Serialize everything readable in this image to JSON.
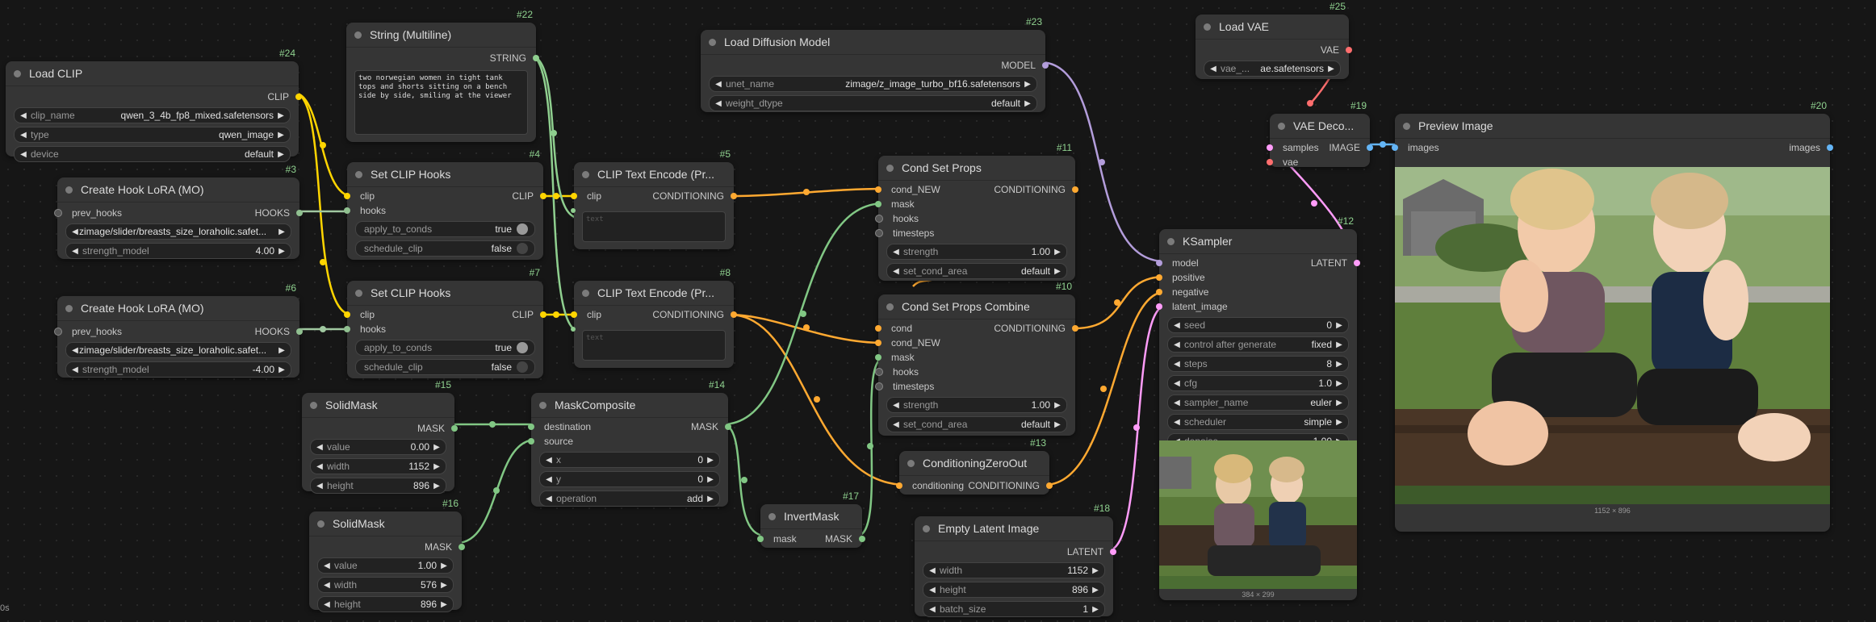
{
  "colors": {
    "clip": "#ffd500",
    "conditioning": "#ffa931",
    "hooks": "#90c090",
    "mask": "#81c784",
    "model": "#b39ddb",
    "latent": "#ff9cf9",
    "vae": "#ff6e6e",
    "image": "#64b5f6",
    "string": "#8fcf8f"
  },
  "footer": {
    "time": "0s"
  },
  "nodes": {
    "load_clip": {
      "id": "#24",
      "title": "Load CLIP",
      "out": "CLIP",
      "clip_name_label": "clip_name",
      "clip_name": "qwen_3_4b_fp8_mixed.safetensors",
      "type_label": "type",
      "type": "qwen_image",
      "device_label": "device",
      "device": "default"
    },
    "string_multiline": {
      "id": "#22",
      "title": "String (Multiline)",
      "out": "STRING",
      "text": "two norwegian women in tight tank tops and shorts sitting on a bench side by side, smiling at the viewer"
    },
    "load_diffusion": {
      "id": "#23",
      "title": "Load Diffusion Model",
      "out": "MODEL",
      "unet_label": "unet_name",
      "unet": "zimage/z_image_turbo_bf16.safetensors",
      "dtype_label": "weight_dtype",
      "dtype": "default"
    },
    "load_vae": {
      "id": "#25",
      "title": "Load VAE",
      "out": "VAE",
      "vae_label": "vae_...",
      "vae": "ae.safetensors"
    },
    "hook_lora_3": {
      "id": "#3",
      "title": "Create Hook LoRA (MO)",
      "in": "prev_hooks",
      "out": "HOOKS",
      "lora": "zimage/slider/breasts_size_loraholic.safet...",
      "strength_label": "strength_model",
      "strength": "4.00"
    },
    "hook_lora_6": {
      "id": "#6",
      "title": "Create Hook LoRA (MO)",
      "in": "prev_hooks",
      "out": "HOOKS",
      "lora": "zimage/slider/breasts_size_loraholic.safet...",
      "strength_label": "strength_model",
      "strength": "-4.00"
    },
    "set_clip_hooks_4": {
      "id": "#4",
      "title": "Set CLIP Hooks",
      "in1": "clip",
      "in2": "hooks",
      "out": "CLIP",
      "apply_label": "apply_to_conds",
      "apply": "true",
      "sched_label": "schedule_clip",
      "sched": "false"
    },
    "set_clip_hooks_7": {
      "id": "#7",
      "title": "Set CLIP Hooks",
      "in1": "clip",
      "in2": "hooks",
      "out": "CLIP",
      "apply_label": "apply_to_conds",
      "apply": "true",
      "sched_label": "schedule_clip",
      "sched": "false"
    },
    "clip_encode_5": {
      "id": "#5",
      "title": "CLIP Text Encode (Pr...",
      "in": "clip",
      "out": "CONDITIONING",
      "placeholder": "text"
    },
    "clip_encode_8": {
      "id": "#8",
      "title": "CLIP Text Encode (Pr...",
      "in": "clip",
      "out": "CONDITIONING",
      "placeholder": "text"
    },
    "cond_set_props": {
      "id": "#11",
      "title": "Cond Set Props",
      "in1": "cond_NEW",
      "in2": "mask",
      "in3": "hooks",
      "in4": "timesteps",
      "out": "CONDITIONING",
      "strength_label": "strength",
      "strength": "1.00",
      "area_label": "set_cond_area",
      "area": "default"
    },
    "cond_set_combine": {
      "id": "#10",
      "title": "Cond Set Props Combine",
      "in1": "cond",
      "in2": "cond_NEW",
      "in3": "mask",
      "in4": "hooks",
      "in5": "timesteps",
      "out": "CONDITIONING",
      "strength_label": "strength",
      "strength": "1.00",
      "area_label": "set_cond_area",
      "area": "default"
    },
    "cond_zero_out": {
      "id": "#13",
      "title": "ConditioningZeroOut",
      "in": "conditioning",
      "out": "CONDITIONING"
    },
    "solidmask_15": {
      "id": "#15",
      "title": "SolidMask",
      "out": "MASK",
      "value_label": "value",
      "value": "0.00",
      "width_label": "width",
      "width": "1152",
      "height_label": "height",
      "height": "896"
    },
    "solidmask_16": {
      "id": "#16",
      "title": "SolidMask",
      "out": "MASK",
      "value_label": "value",
      "value": "1.00",
      "width_label": "width",
      "width": "576",
      "height_label": "height",
      "height": "896"
    },
    "mask_composite": {
      "id": "#14",
      "title": "MaskComposite",
      "in1": "destination",
      "in2": "source",
      "out": "MASK",
      "x_label": "x",
      "x": "0",
      "y_label": "y",
      "y": "0",
      "op_label": "operation",
      "op": "add"
    },
    "invert_mask": {
      "id": "#17",
      "title": "InvertMask",
      "in": "mask",
      "out": "MASK"
    },
    "empty_latent": {
      "id": "#18",
      "title": "Empty Latent Image",
      "out": "LATENT",
      "width_label": "width",
      "width": "1152",
      "height_label": "height",
      "height": "896",
      "batch_label": "batch_size",
      "batch": "1"
    },
    "ksampler": {
      "id": "#12",
      "title": "KSampler",
      "in1": "model",
      "in2": "positive",
      "in3": "negative",
      "in4": "latent_image",
      "out": "LATENT",
      "seed_label": "seed",
      "seed": "0",
      "cag_label": "control after generate",
      "cag": "fixed",
      "steps_label": "steps",
      "steps": "8",
      "cfg_label": "cfg",
      "cfg": "1.0",
      "sampler_label": "sampler_name",
      "sampler": "euler",
      "scheduler_label": "scheduler",
      "scheduler": "simple",
      "denoise_label": "denoise",
      "denoise": "1.00",
      "preview_size": "384 × 299"
    },
    "vae_decode": {
      "id": "#19",
      "title": "VAE Deco...",
      "in1": "samples",
      "in2": "vae",
      "out": "IMAGE"
    },
    "preview_image": {
      "id": "#20",
      "title": "Preview Image",
      "in": "images",
      "out": "images",
      "size": "1152 × 896"
    }
  }
}
